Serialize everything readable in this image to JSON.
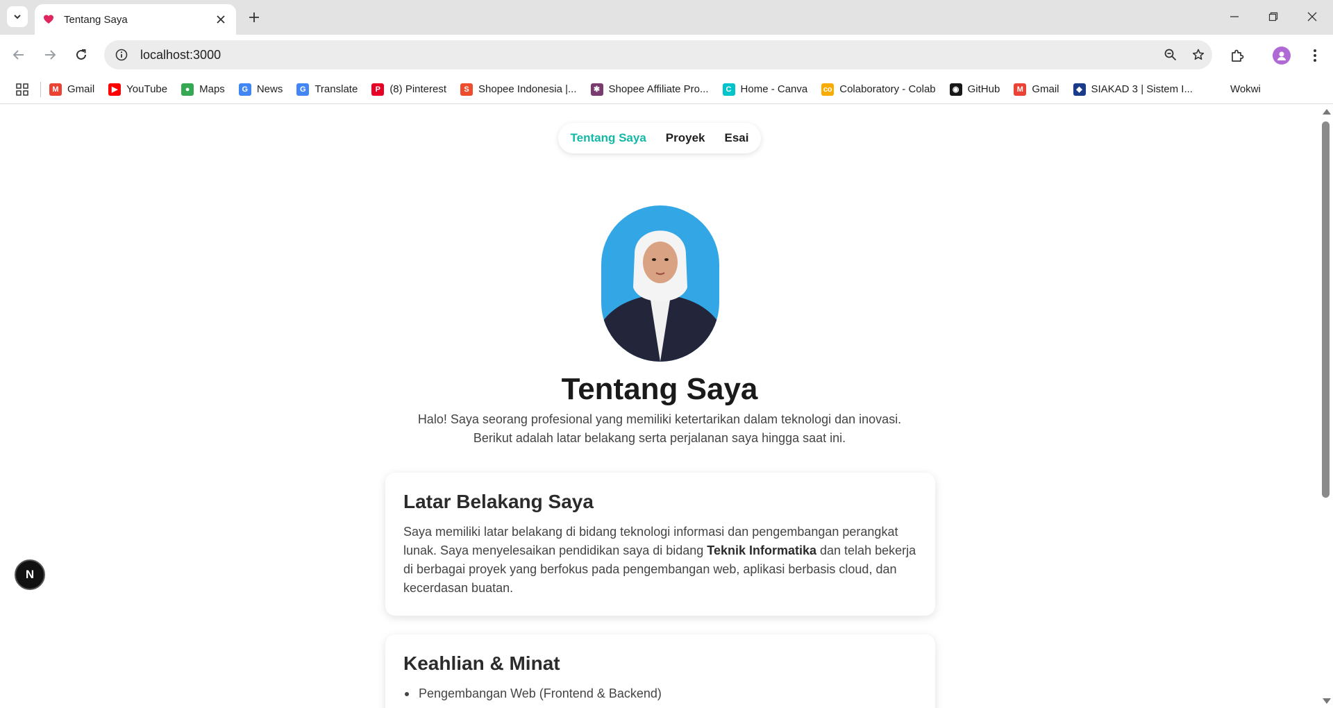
{
  "browser": {
    "tab_title": "Tentang Saya",
    "url": "localhost:3000",
    "bookmarks": [
      {
        "label": "Gmail",
        "icon": "gmail-icon",
        "color": "#ea4335",
        "glyph": "M"
      },
      {
        "label": "YouTube",
        "icon": "youtube-icon",
        "color": "#ff0000",
        "glyph": "▶"
      },
      {
        "label": "Maps",
        "icon": "maps-icon",
        "color": "#34a853",
        "glyph": "●"
      },
      {
        "label": "News",
        "icon": "news-icon",
        "color": "#4285f4",
        "glyph": "G"
      },
      {
        "label": "Translate",
        "icon": "translate-icon",
        "color": "#4285f4",
        "glyph": "G"
      },
      {
        "label": "(8) Pinterest",
        "icon": "pinterest-icon",
        "color": "#e60023",
        "glyph": "P"
      },
      {
        "label": "Shopee Indonesia |...",
        "icon": "shopee-icon",
        "color": "#ee4d2d",
        "glyph": "S"
      },
      {
        "label": "Shopee Affiliate Pro...",
        "icon": "shopee-affiliate-icon",
        "color": "#7a3b6f",
        "glyph": "✱"
      },
      {
        "label": "Home - Canva",
        "icon": "canva-icon",
        "color": "#00c4cc",
        "glyph": "C"
      },
      {
        "label": "Colaboratory - Colab",
        "icon": "colab-icon",
        "color": "#f9ab00",
        "glyph": "co"
      },
      {
        "label": "GitHub",
        "icon": "github-icon",
        "color": "#181717",
        "glyph": "◉"
      },
      {
        "label": "Gmail",
        "icon": "gmail-icon",
        "color": "#ea4335",
        "glyph": "M"
      },
      {
        "label": "SIAKAD 3 | Sistem I...",
        "icon": "siakad-icon",
        "color": "#1a3a8a",
        "glyph": "◆"
      },
      {
        "label": "Wokwi",
        "icon": "wokwi-icon",
        "color": "#ffffff",
        "glyph": ""
      }
    ]
  },
  "nav": {
    "items": [
      {
        "label": "Tentang Saya",
        "active": true
      },
      {
        "label": "Proyek",
        "active": false
      },
      {
        "label": "Esai",
        "active": false
      }
    ]
  },
  "hero": {
    "title": "Tentang Saya",
    "intro_line1": "Halo! Saya seorang profesional yang memiliki ketertarikan dalam teknologi dan inovasi.",
    "intro_line2": "Berikut adalah latar belakang serta perjalanan saya hingga saat ini."
  },
  "background": {
    "heading": "Latar Belakang Saya",
    "text_before": "Saya memiliki latar belakang di bidang teknologi informasi dan pengembangan perangkat lunak. Saya menyelesaikan pendidikan saya di bidang ",
    "text_bold": "Teknik Informatika",
    "text_after": " dan telah bekerja di berbagai proyek yang berfokus pada pengembangan web, aplikasi berbasis cloud, dan kecerdasan buatan."
  },
  "skills": {
    "heading": "Keahlian & Minat",
    "items": [
      "Pengembangan Web (Frontend & Backend)"
    ]
  },
  "dev_badge": "N",
  "colors": {
    "accent": "#14b8a6",
    "profile_bg": "#33a6e6"
  }
}
